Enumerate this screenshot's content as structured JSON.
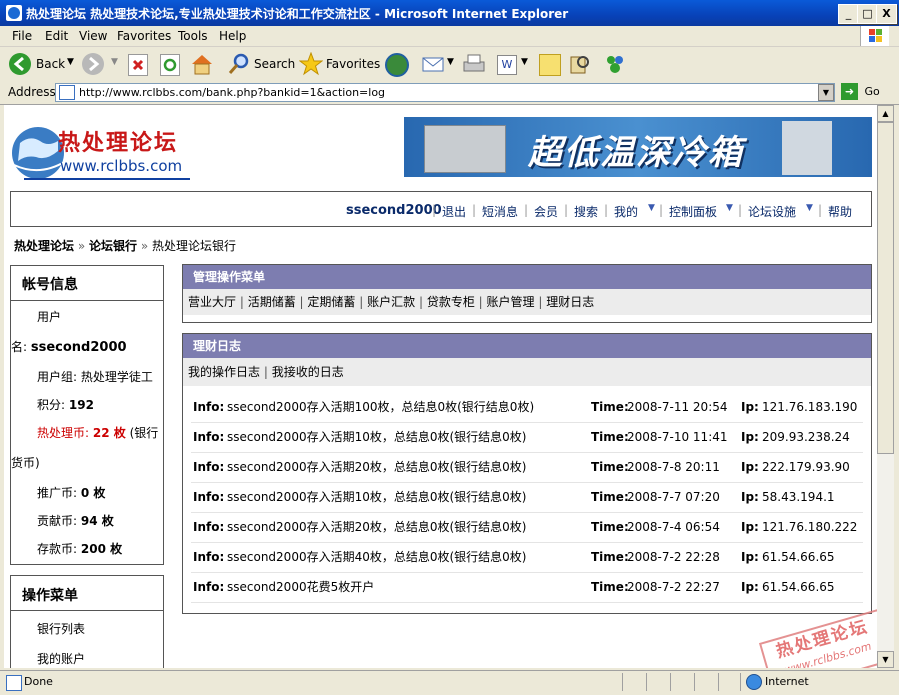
{
  "window": {
    "title": "热处理论坛 热处理技术论坛,专业热处理技术讨论和工作交流社区 - Microsoft Internet Explorer",
    "minimize": "_",
    "maximize": "□",
    "close": "X"
  },
  "menu": [
    "File",
    "Edit",
    "View",
    "Favorites",
    "Tools",
    "Help"
  ],
  "toolbar": {
    "back": "Back",
    "search": "Search",
    "favorites": "Favorites"
  },
  "address": {
    "label": "Address",
    "url": "http://www.rclbbs.com/bank.php?bankid=1&action=log",
    "go": "Go"
  },
  "site": {
    "logo_cn": "热处理论坛",
    "logo_url": "www.rclbbs.com",
    "banner_text": "超低温深冷箱"
  },
  "navbar": {
    "username": "ssecond2000",
    "links": [
      "退出",
      "短消息",
      "会员",
      "搜索",
      "我的",
      "控制面板",
      "论坛设施",
      "帮助"
    ]
  },
  "breadcrumb": {
    "home": "热处理论坛",
    "bank": "论坛银行",
    "current": "热处理论坛银行"
  },
  "account": {
    "title": "帐号信息",
    "user_label_1": "用户",
    "user_label_2": "名:",
    "username": "ssecond2000",
    "group": "用户组: 热处理学徒工",
    "points_label": "积分:",
    "points": "192",
    "coin_label": "热处理币:",
    "coin": "22 枚",
    "coin_note_1": "(银行",
    "coin_note_2": "货币)",
    "promo_label": "推广币:",
    "promo": "0 枚",
    "contrib_label": "贡献币:",
    "contrib": "94 枚",
    "deposit_label": "存款币:",
    "deposit": "200 枚"
  },
  "ops_menu": {
    "title": "操作菜单",
    "items": [
      "银行列表",
      "我的账户"
    ]
  },
  "admin_menu": {
    "title": "管理操作菜单",
    "items": [
      "营业大厅",
      "活期储蓄",
      "定期储蓄",
      "账户汇款",
      "贷款专柜",
      "账户管理",
      "理财日志"
    ]
  },
  "log_panel": {
    "title": "理财日志",
    "tabs": [
      "我的操作日志",
      "我接收的日志"
    ],
    "info_label": "Info:",
    "time_label": "Time:",
    "ip_label": "Ip:",
    "rows": [
      {
        "info": "ssecond2000存入活期100枚，总结息0枚(银行结息0枚)",
        "time": "2008-7-11 20:54",
        "ip": "121.76.183.190"
      },
      {
        "info": "ssecond2000存入活期10枚，总结息0枚(银行结息0枚)",
        "time": "2008-7-10 11:41",
        "ip": "209.93.238.24"
      },
      {
        "info": "ssecond2000存入活期20枚，总结息0枚(银行结息0枚)",
        "time": "2008-7-8 20:11",
        "ip": "222.179.93.90"
      },
      {
        "info": "ssecond2000存入活期10枚，总结息0枚(银行结息0枚)",
        "time": "2008-7-7 07:20",
        "ip": "58.43.194.1"
      },
      {
        "info": "ssecond2000存入活期20枚，总结息0枚(银行结息0枚)",
        "time": "2008-7-4 06:54",
        "ip": "121.76.180.222"
      },
      {
        "info": "ssecond2000存入活期40枚，总结息0枚(银行结息0枚)",
        "time": "2008-7-2 22:28",
        "ip": "61.54.66.65"
      },
      {
        "info": "ssecond2000花费5枚开户",
        "time": "2008-7-2 22:27",
        "ip": "61.54.66.65"
      }
    ]
  },
  "status": {
    "text": "Done",
    "zone": "Internet"
  },
  "watermark": {
    "cn": "热处理论坛",
    "url": "www.rclbbs.com"
  },
  "colors": {
    "panel_header": "#7d7db0",
    "coin_red": "#cc0000",
    "link_blue": "#0a2a6a"
  }
}
